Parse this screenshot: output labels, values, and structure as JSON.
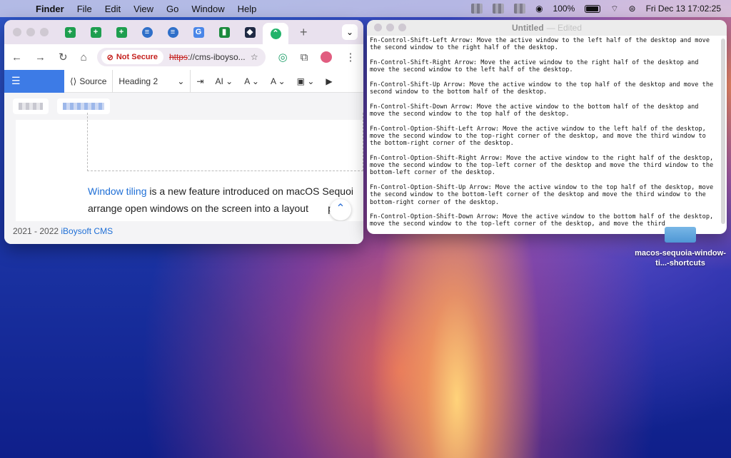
{
  "menubar": {
    "app_name": "Finder",
    "menus": [
      "File",
      "Edit",
      "View",
      "Go",
      "Window",
      "Help"
    ],
    "battery": "100%",
    "clock": "Fri Dec 13  17:02:25"
  },
  "browser": {
    "security_label": "Not Secure",
    "url_scheme": "https",
    "url_rest": "://cms-iboyso...",
    "tab_icons": [
      "sheets-icon",
      "sheets-icon",
      "sheets-icon",
      "globe-icon",
      "globe-icon",
      "translate-icon",
      "calendar-icon",
      "dark-app-icon",
      "green-app-icon"
    ],
    "accent": "#3d7be6"
  },
  "editor": {
    "source_label": "Source",
    "heading_label": "Heading 2"
  },
  "article": {
    "link_text": "Window tiling",
    "text_line1": " is a new feature introduced on macOS Sequoi",
    "text_line2": "arrange open windows on the screen into a layout",
    "text_line2_tail": "prefe"
  },
  "footer": {
    "copyright": "2021 - 2022 ",
    "brand": "iBoysoft CMS"
  },
  "textedit": {
    "title": "Untitled",
    "edited": "— Edited",
    "paragraphs": [
      "Fn-Control-Shift-Left Arrow: Move the active window to the left half of the desktop and move the second window to the right half of the desktop.",
      "Fn-Control-Shift-Right Arrow: Move the active window to the right half of the desktop and move the second window to the left half of the desktop.",
      "Fn-Control-Shift-Up Arrow: Move the active window to the top half of the desktop and move the second window to the bottom half of the desktop.",
      "Fn-Control-Shift-Down Arrow: Move the active window to the bottom half of the desktop and move the second window to the top half of the desktop.",
      "Fn-Control-Option-Shift-Left Arrow: Move the active window to the left half of the desktop, move the second window to the top-right corner of the desktop, and move the third window to the bottom-right corner of the desktop.",
      "Fn-Control-Option-Shift-Right Arrow: Move the active window to the right half of the desktop, move the second window to the top-left corner of the desktop and move the third window to the bottom-left corner of the desktop.",
      "Fn-Control-Option-Shift-Up Arrow: Move the active window to the top half of the desktop, move the second window to the bottom-left corner of the desktop and move the third window to the bottom-right corner of the desktop.",
      "Fn-Control-Option-Shift-Down Arrow: Move the active window to the bottom half of the desktop, move the second window to the top-left corner of the desktop, and move the third"
    ]
  },
  "desktop": {
    "file_label": "macos-sequoia-window-ti...-shortcuts"
  }
}
